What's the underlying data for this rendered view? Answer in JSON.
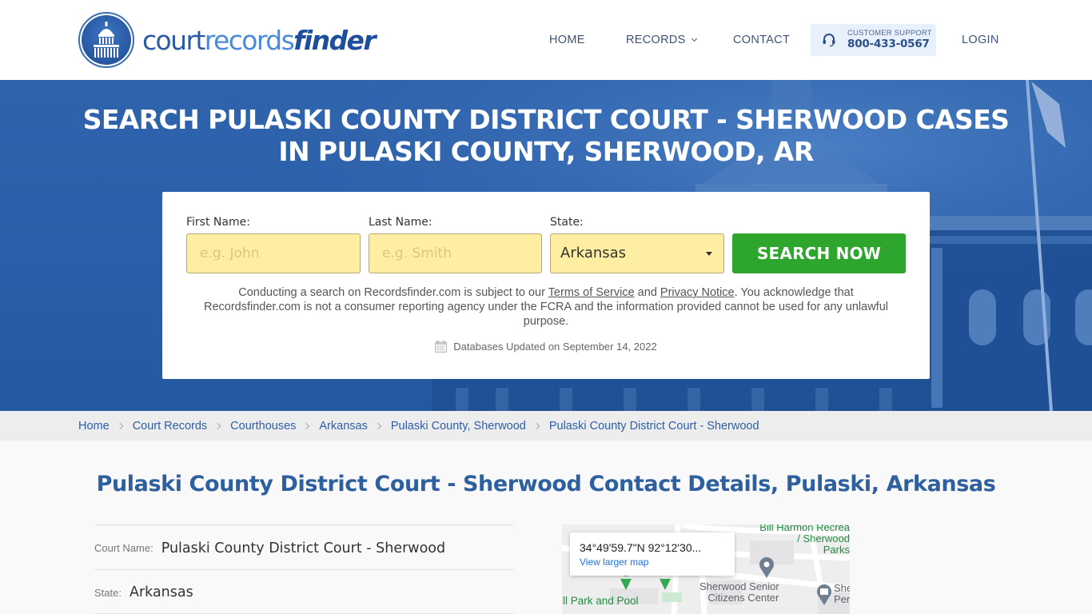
{
  "header": {
    "logo": {
      "part1": "court",
      "part2": "records",
      "part3": "finder"
    },
    "nav": {
      "home": "HOME",
      "records": "RECORDS",
      "contact": "CONTACT",
      "login": "LOGIN"
    },
    "support": {
      "label": "CUSTOMER SUPPORT",
      "phone": "800-433-0567"
    }
  },
  "hero": {
    "title_line1": "SEARCH PULASKI COUNTY DISTRICT COURT - SHERWOOD CASES",
    "title_line2": "IN PULASKI COUNTY, SHERWOOD, AR"
  },
  "search": {
    "first_name": {
      "label": "First Name:",
      "placeholder": "e.g. John",
      "value": ""
    },
    "last_name": {
      "label": "Last Name:",
      "placeholder": "e.g. Smith",
      "value": ""
    },
    "state": {
      "label": "State:",
      "selected": "Arkansas"
    },
    "button": "SEARCH NOW",
    "disclaimer": {
      "before": "Conducting a search on Recordsfinder.com is subject to our ",
      "terms": "Terms of Service",
      "and": " and ",
      "privacy": "Privacy Notice",
      "after": ". You acknowledge that Recordsfinder.com is not a consumer reporting agency under the FCRA and the information provided cannot be used for any unlawful purpose."
    },
    "db_updated": "Databases Updated on September 14, 2022"
  },
  "breadcrumb": [
    "Home",
    "Court Records",
    "Courthouses",
    "Arkansas",
    "Pulaski County, Sherwood",
    "Pulaski County District Court - Sherwood"
  ],
  "main": {
    "title": "Pulaski County District Court - Sherwood Contact Details, Pulaski, Arkansas",
    "details": [
      {
        "label": "Court Name:",
        "value": "Pulaski County District Court - Sherwood"
      },
      {
        "label": "State:",
        "value": "Arkansas"
      }
    ]
  },
  "map": {
    "coords": "34°49'59.7\"N 92°12'30...",
    "link": "View larger map",
    "places": {
      "recreation_line1": "Bill Harmon Recrea",
      "recreation_line2": "/ Sherwood Parks",
      "park": "ill Park and Pool",
      "senior_line1": "Sherwood Senior",
      "senior_line2": "Citizens Center",
      "museum_line1": "She",
      "museum_line2": "Per"
    }
  },
  "colors": {
    "brand_blue": "#2e5ea5",
    "hero_blue": "#2a5ea8",
    "search_green": "#2ea52c",
    "input_yellow": "#fdeea1",
    "support_bg": "#e8f1fb"
  }
}
